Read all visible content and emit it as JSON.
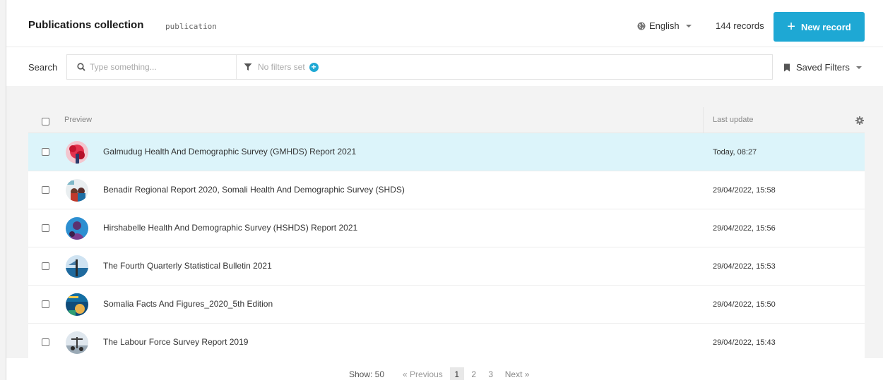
{
  "header": {
    "title": "Publications collection",
    "subtitle": "publication",
    "language": "English",
    "records_count": "144 records",
    "new_record_label": "New record",
    "accent_color": "#1ea8d4"
  },
  "search": {
    "label": "Search",
    "placeholder": "Type something...",
    "filters_text": "No filters set",
    "saved_filters_label": "Saved Filters"
  },
  "table": {
    "columns": {
      "preview": "Preview",
      "last_update": "Last update"
    },
    "rows": [
      {
        "title": "Galmudug Health And Demographic Survey (GMHDS) Report 2021",
        "date": "Today, 08:27",
        "selected": true
      },
      {
        "title": "Benadir Regional Report 2020, Somali Health And Demographic Survey (SHDS)",
        "date": "29/04/2022, 15:58"
      },
      {
        "title": "Hirshabelle Health And Demographic Survey (HSHDS) Report 2021",
        "date": "29/04/2022, 15:56"
      },
      {
        "title": "The Fourth Quarterly Statistical Bulletin 2021",
        "date": "29/04/2022, 15:53"
      },
      {
        "title": "Somalia Facts And Figures_2020_5th Edition",
        "date": "29/04/2022, 15:50"
      },
      {
        "title": "The Labour Force Survey Report 2019",
        "date": "29/04/2022, 15:43"
      }
    ]
  },
  "pagination": {
    "show": "Show: 50",
    "previous": "« Previous",
    "pages": [
      "1",
      "2",
      "3"
    ],
    "current_page": "1",
    "next": "Next »"
  }
}
